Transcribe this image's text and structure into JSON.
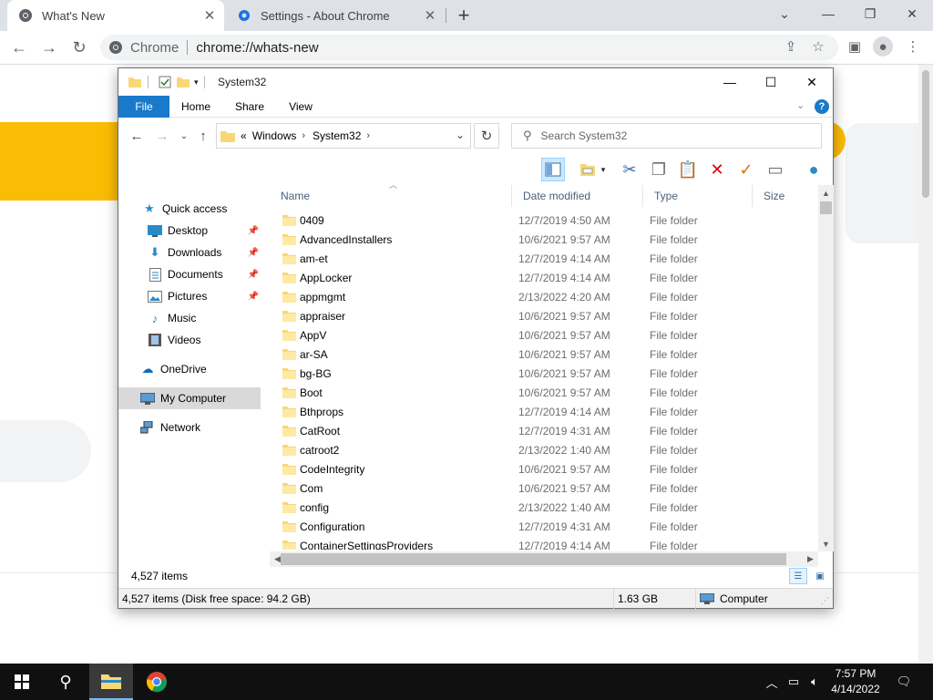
{
  "browser": {
    "tabs": [
      {
        "title": "What's New",
        "active": true
      },
      {
        "title": "Settings - About Chrome",
        "active": false
      }
    ],
    "omnibox": {
      "origin": "Chrome",
      "url": "chrome://whats-new"
    },
    "window_controls": {
      "minimize": "minimize",
      "restore": "restore",
      "close": "close"
    }
  },
  "explorer": {
    "title": "System32",
    "ribbon_tabs": [
      "File",
      "Home",
      "Share",
      "View"
    ],
    "help_label": "?",
    "address": {
      "prefix": "«",
      "crumbs": [
        "Windows",
        "System32"
      ]
    },
    "search_placeholder": "Search System32",
    "nav": [
      {
        "label": "Quick access",
        "icon": "star-icon"
      },
      {
        "label": "Desktop",
        "icon": "desktop-icon",
        "pinned": true
      },
      {
        "label": "Downloads",
        "icon": "download-icon",
        "pinned": true
      },
      {
        "label": "Documents",
        "icon": "document-icon",
        "pinned": true
      },
      {
        "label": "Pictures",
        "icon": "picture-icon",
        "pinned": true
      },
      {
        "label": "Music",
        "icon": "music-icon"
      },
      {
        "label": "Videos",
        "icon": "video-icon"
      },
      {
        "label": "OneDrive",
        "icon": "cloud-icon"
      },
      {
        "label": "My Computer",
        "icon": "computer-icon",
        "selected": true
      },
      {
        "label": "Network",
        "icon": "network-icon"
      }
    ],
    "columns": {
      "name": "Name",
      "date": "Date modified",
      "type": "Type",
      "size": "Size"
    },
    "files": [
      {
        "name": "0409",
        "date": "12/7/2019 4:50 AM",
        "type": "File folder"
      },
      {
        "name": "AdvancedInstallers",
        "date": "10/6/2021 9:57 AM",
        "type": "File folder"
      },
      {
        "name": "am-et",
        "date": "12/7/2019 4:14 AM",
        "type": "File folder"
      },
      {
        "name": "AppLocker",
        "date": "12/7/2019 4:14 AM",
        "type": "File folder"
      },
      {
        "name": "appmgmt",
        "date": "2/13/2022 4:20 AM",
        "type": "File folder"
      },
      {
        "name": "appraiser",
        "date": "10/6/2021 9:57 AM",
        "type": "File folder"
      },
      {
        "name": "AppV",
        "date": "10/6/2021 9:57 AM",
        "type": "File folder"
      },
      {
        "name": "ar-SA",
        "date": "10/6/2021 9:57 AM",
        "type": "File folder"
      },
      {
        "name": "bg-BG",
        "date": "10/6/2021 9:57 AM",
        "type": "File folder"
      },
      {
        "name": "Boot",
        "date": "10/6/2021 9:57 AM",
        "type": "File folder"
      },
      {
        "name": "Bthprops",
        "date": "12/7/2019 4:14 AM",
        "type": "File folder"
      },
      {
        "name": "CatRoot",
        "date": "12/7/2019 4:31 AM",
        "type": "File folder"
      },
      {
        "name": "catroot2",
        "date": "2/13/2022 1:40 AM",
        "type": "File folder"
      },
      {
        "name": "CodeIntegrity",
        "date": "10/6/2021 9:57 AM",
        "type": "File folder"
      },
      {
        "name": "Com",
        "date": "10/6/2021 9:57 AM",
        "type": "File folder"
      },
      {
        "name": "config",
        "date": "2/13/2022 1:40 AM",
        "type": "File folder"
      },
      {
        "name": "Configuration",
        "date": "12/7/2019 4:31 AM",
        "type": "File folder"
      },
      {
        "name": "ContainerSettingsProviders",
        "date": "12/7/2019 4:14 AM",
        "type": "File folder"
      }
    ],
    "item_count": "4,527 items",
    "status": {
      "summary": "4,527 items (Disk free space: 94.2 GB)",
      "size": "1.63 GB",
      "location": "Computer"
    }
  },
  "taskbar": {
    "time": "7:57 PM",
    "date": "4/14/2022"
  },
  "colors": {
    "accent": "#1979ca",
    "chrome_tabstrip": "#dee1e6",
    "folder": "#f8d775",
    "taskbar": "#101010"
  }
}
